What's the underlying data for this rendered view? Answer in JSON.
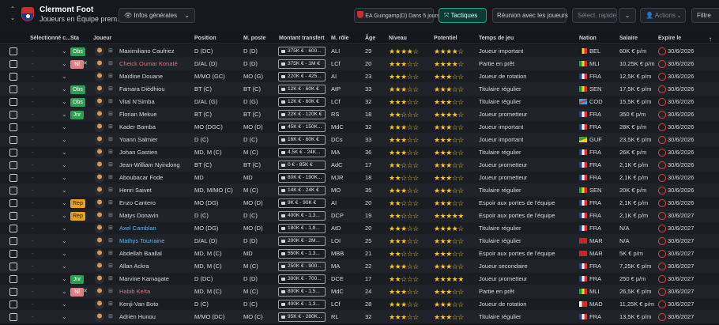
{
  "header": {
    "club": "Clermont Foot",
    "squad": "Joueurs en Équipe prem. (34)",
    "view_button": "Infos générales",
    "match_info": "EA Guingamp(D) Dans 5 jours",
    "tactics": "Tactiques",
    "meeting": "Réunion avec les joueurs",
    "quick_select": "Sélect. rapide",
    "actions": "Actions",
    "filter": "Filtre"
  },
  "columns": {
    "selected": "Sélectionné c...",
    "status": "Sta",
    "player": "Joueur",
    "position": "Position",
    "match_position": "M. poste",
    "transfer": "Montant transfert",
    "role": "M. rôle",
    "age": "Âge",
    "level": "Niveau",
    "potential": "Potentiel",
    "playing_time": "Temps de jeu",
    "nation": "Nation",
    "salary": "Salaire",
    "expires": "Expire le"
  },
  "colors": {
    "accent_teal": "#13a38a",
    "badge_green": "#2f9e52",
    "badge_orange": "#e8a318",
    "badge_pink": "#e07f86",
    "star": "#f0c23a",
    "expiry_red": "#e0443e"
  },
  "rows": [
    {
      "badge": "Obs",
      "name": "Maximiliano Caufriez",
      "pos": "D (DC)",
      "mpos": "D (D)",
      "fee": "375K € - 600...",
      "role": "ALI",
      "age": "29",
      "level": "★★★★☆",
      "potential": "★★★★☆",
      "playtime": "Joueur important",
      "nation": "BEL",
      "salary": "60K € p/m",
      "expires": "30/6/2026"
    },
    {
      "badge": "Nl",
      "name": "Cheick Oumar Konaté",
      "pos": "D/AL (D)",
      "mpos": "D (D)",
      "fee": "375K € - 1M €",
      "role": "LCf",
      "age": "20",
      "level": "★★★☆☆",
      "potential": "★★★★☆",
      "playtime": "Partie en prêt",
      "nation": "MLI",
      "salary": "10,25K € p/m",
      "expires": "30/6/2026"
    },
    {
      "badge": "",
      "name": "Maïdine Douane",
      "pos": "M/MO (GC)",
      "mpos": "MO (G)",
      "fee": "220K € - 425...",
      "role": "AI",
      "age": "23",
      "level": "★★★☆☆",
      "potential": "★★★☆☆",
      "playtime": "Joueur de rotation",
      "nation": "FRA",
      "salary": "12,5K € p/m",
      "expires": "30/6/2026"
    },
    {
      "badge": "Obs",
      "name": "Famara Diédhiou",
      "pos": "BT (C)",
      "mpos": "BT (C)",
      "fee": "12K € - 60K €",
      "role": "AtP",
      "age": "33",
      "level": "★★★☆☆",
      "potential": "★★★☆☆",
      "playtime": "Titulaire régulier",
      "nation": "SEN",
      "salary": "17,5K € p/m",
      "expires": "30/6/2026"
    },
    {
      "badge": "Obs",
      "name": "Vital N'Simba",
      "pos": "D/AL (G)",
      "mpos": "D (G)",
      "fee": "12K € - 60K €",
      "role": "LCf",
      "age": "32",
      "level": "★★★☆☆",
      "potential": "★★★☆☆",
      "playtime": "Titulaire régulier",
      "nation": "COD",
      "salary": "15,5K € p/m",
      "expires": "30/6/2026"
    },
    {
      "badge": "Jnr",
      "name": "Florian Mekue",
      "pos": "BT (C)",
      "mpos": "BT (C)",
      "fee": "22K € - 120K €",
      "role": "RS",
      "age": "18",
      "level": "★★☆☆☆",
      "potential": "★★★★☆",
      "playtime": "Joueur prometteur",
      "nation": "FRA",
      "salary": "350 € p/m",
      "expires": "30/6/2026"
    },
    {
      "badge": "",
      "name": "Kader Bamba",
      "pos": "MO (DGC)",
      "mpos": "MO (D)",
      "fee": "45K € - 150K...",
      "role": "MdC",
      "age": "32",
      "level": "★★★☆☆",
      "potential": "★★★☆☆",
      "playtime": "Joueur important",
      "nation": "FRA",
      "salary": "28K € p/m",
      "expires": "30/6/2026"
    },
    {
      "badge": "",
      "name": "Yoann Salmier",
      "pos": "D (C)",
      "mpos": "D (C)",
      "fee": "16K € - 60K €",
      "role": "DCs",
      "age": "33",
      "level": "★★★☆☆",
      "potential": "★★★☆☆",
      "playtime": "Joueur important",
      "nation": "GUF",
      "salary": "23,5K € p/m",
      "expires": "30/6/2026"
    },
    {
      "badge": "",
      "name": "Johan Gastien",
      "pos": "MD, M (C)",
      "mpos": "M (C)",
      "fee": "4,5K € - 24K...",
      "role": "MA",
      "age": "36",
      "level": "★★★☆☆",
      "potential": "★★★☆☆",
      "playtime": "Titulaire régulier",
      "nation": "FRA",
      "salary": "26K € p/m",
      "expires": "30/6/2026"
    },
    {
      "badge": "",
      "name": "Jean-William Nyindong",
      "pos": "BT (C)",
      "mpos": "BT (C)",
      "fee": "0 € - 85K €",
      "role": "AdC",
      "age": "17",
      "level": "★★☆☆☆",
      "potential": "★★★☆☆",
      "playtime": "Joueur prometteur",
      "nation": "FRA",
      "salary": "2,1K € p/m",
      "expires": "30/6/2026"
    },
    {
      "badge": "",
      "name": "Aboubacar Fode",
      "pos": "MD",
      "mpos": "MD",
      "fee": "80K € - 190K...",
      "role": "MJR",
      "age": "18",
      "level": "★★☆☆☆",
      "potential": "★★★☆☆",
      "playtime": "Joueur prometteur",
      "nation": "FRA",
      "salary": "2,1K € p/m",
      "expires": "30/6/2026"
    },
    {
      "badge": "",
      "name": "Henri Saivet",
      "pos": "MD, M/MO (C)",
      "mpos": "M (C)",
      "fee": "14K € - 24K €",
      "role": "MO",
      "age": "35",
      "level": "★★★☆☆",
      "potential": "★★★☆☆",
      "playtime": "Titulaire régulier",
      "nation": "SEN",
      "salary": "20K € p/m",
      "expires": "30/6/2026"
    },
    {
      "badge": "Rep",
      "name": "Enzo Cantero",
      "pos": "MO (DG)",
      "mpos": "MO (D)",
      "fee": "9K € - 90K €",
      "role": "AI",
      "age": "20",
      "level": "★★☆☆☆",
      "potential": "★★★☆☆",
      "playtime": "Espoir aux portes de l'équipe",
      "nation": "FRA",
      "salary": "2,1K € p/m",
      "expires": "30/6/2026"
    },
    {
      "badge": "Rep",
      "name": "Matys Donavin",
      "pos": "D (C)",
      "mpos": "D (C)",
      "fee": "400K € - 1,3...",
      "role": "DCP",
      "age": "19",
      "level": "★★☆☆☆",
      "potential": "★★★★★",
      "playtime": "Espoir aux portes de l'équipe",
      "nation": "FRA",
      "salary": "2,1K € p/m",
      "expires": "30/6/2027"
    },
    {
      "badge": "",
      "name": "Axel Camblan",
      "pos": "MO (DG)",
      "mpos": "MO (D)",
      "fee": "180K € - 1,8...",
      "role": "AtD",
      "age": "20",
      "level": "★★★☆☆",
      "potential": "★★★★☆",
      "playtime": "Titulaire régulier",
      "nation": "FRA",
      "salary": "N/A",
      "expires": "30/6/2027"
    },
    {
      "badge": "",
      "name": "Mathys Tourraine",
      "pos": "D/AL (D)",
      "mpos": "D (D)",
      "fee": "200K € - 2M...",
      "role": "LOI",
      "age": "25",
      "level": "★★★☆☆",
      "potential": "★★★☆☆",
      "playtime": "Titulaire régulier",
      "nation": "MAR",
      "salary": "N/A",
      "expires": "30/6/2027"
    },
    {
      "badge": "",
      "name": "Abdellah Baallal",
      "pos": "MD, M (C)",
      "mpos": "MD",
      "fee": "550K € - 1,3...",
      "role": "MBB",
      "age": "21",
      "level": "★★☆☆☆",
      "potential": "★★★☆☆",
      "playtime": "Espoir aux portes de l'équipe",
      "nation": "MAR",
      "salary": "5K € p/m",
      "expires": "30/6/2027"
    },
    {
      "badge": "",
      "name": "Allan Ackra",
      "pos": "MD, M (C)",
      "mpos": "M (C)",
      "fee": "250K € - 900...",
      "role": "MA",
      "age": "22",
      "level": "★★★☆☆",
      "potential": "★★★☆☆",
      "playtime": "Joueur secondaire",
      "nation": "FRA",
      "salary": "7,25K € p/m",
      "expires": "30/6/2027"
    },
    {
      "badge": "Jnr",
      "name": "Marvine Kamagate",
      "pos": "D (DC)",
      "mpos": "D (D)",
      "fee": "300K € - 700...",
      "role": "DCE",
      "age": "17",
      "level": "★★☆☆☆",
      "potential": "★★★★★",
      "playtime": "Joueur prometteur",
      "nation": "FRA",
      "salary": "250 € p/m",
      "expires": "30/6/2027"
    },
    {
      "badge": "Nl",
      "name": "Habib Keïta",
      "pos": "MD, M (C)",
      "mpos": "M (C)",
      "fee": "800K € - 1,5...",
      "role": "MdC",
      "age": "24",
      "level": "★★★☆☆",
      "potential": "★★★☆☆",
      "playtime": "Partie en prêt",
      "nation": "MLI",
      "salary": "26,5K € p/m",
      "expires": "30/6/2027"
    },
    {
      "badge": "",
      "name": "Kenji-Van Boto",
      "pos": "D (C)",
      "mpos": "D (C)",
      "fee": "400K € - 1,3...",
      "role": "LCf",
      "age": "28",
      "level": "★★★☆☆",
      "potential": "★★★☆☆",
      "playtime": "Joueur de rotation",
      "nation": "MAD",
      "salary": "11,25K € p/m",
      "expires": "30/6/2027"
    },
    {
      "badge": "",
      "name": "Adrien Hunou",
      "pos": "M/MO (DC)",
      "mpos": "MO (C)",
      "fee": "95K € - 280K...",
      "role": "RL",
      "age": "32",
      "level": "★★★☆☆",
      "potential": "★★★☆☆",
      "playtime": "Titulaire régulier",
      "nation": "FRA",
      "salary": "13,5K € p/m",
      "expires": "30/6/2027"
    }
  ]
}
